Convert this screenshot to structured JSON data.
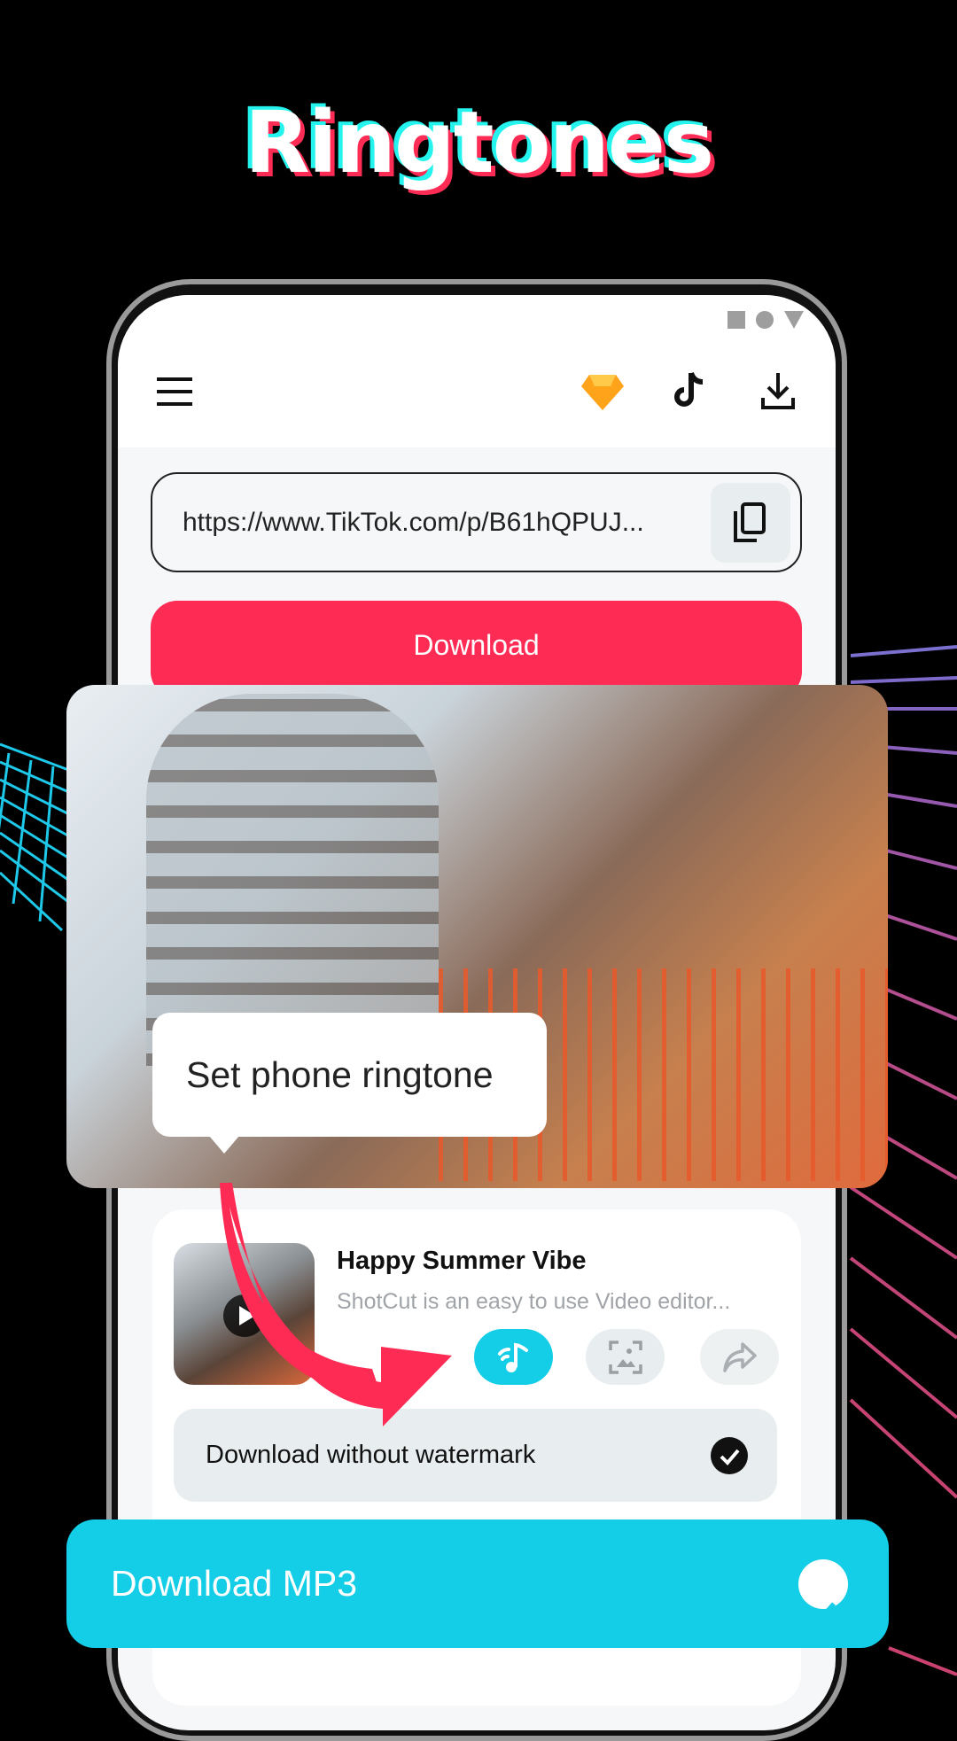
{
  "headline": "Ringtones",
  "url_field": {
    "value": "https://www.TikTok.com/p/B61hQPUJ..."
  },
  "download_button": "Download",
  "tooltip": "Set phone ringtone",
  "video": {
    "title": "Happy Summer Vibe",
    "description": "ShotCut is an easy to use Video editor..."
  },
  "watermark_option": {
    "label": "Download without watermark",
    "checked": true
  },
  "mp3_banner": {
    "label": "Download MP3",
    "checked": true
  },
  "colors": {
    "accent_red": "#fe2c55",
    "accent_cyan": "#14cde6",
    "premium": "#ffa31a"
  },
  "icons": [
    "menu-icon",
    "diamond-icon",
    "tiktok-icon",
    "download-icon",
    "copy-icon",
    "play-icon",
    "ringtone-icon",
    "image-icon",
    "share-icon",
    "check-icon"
  ]
}
